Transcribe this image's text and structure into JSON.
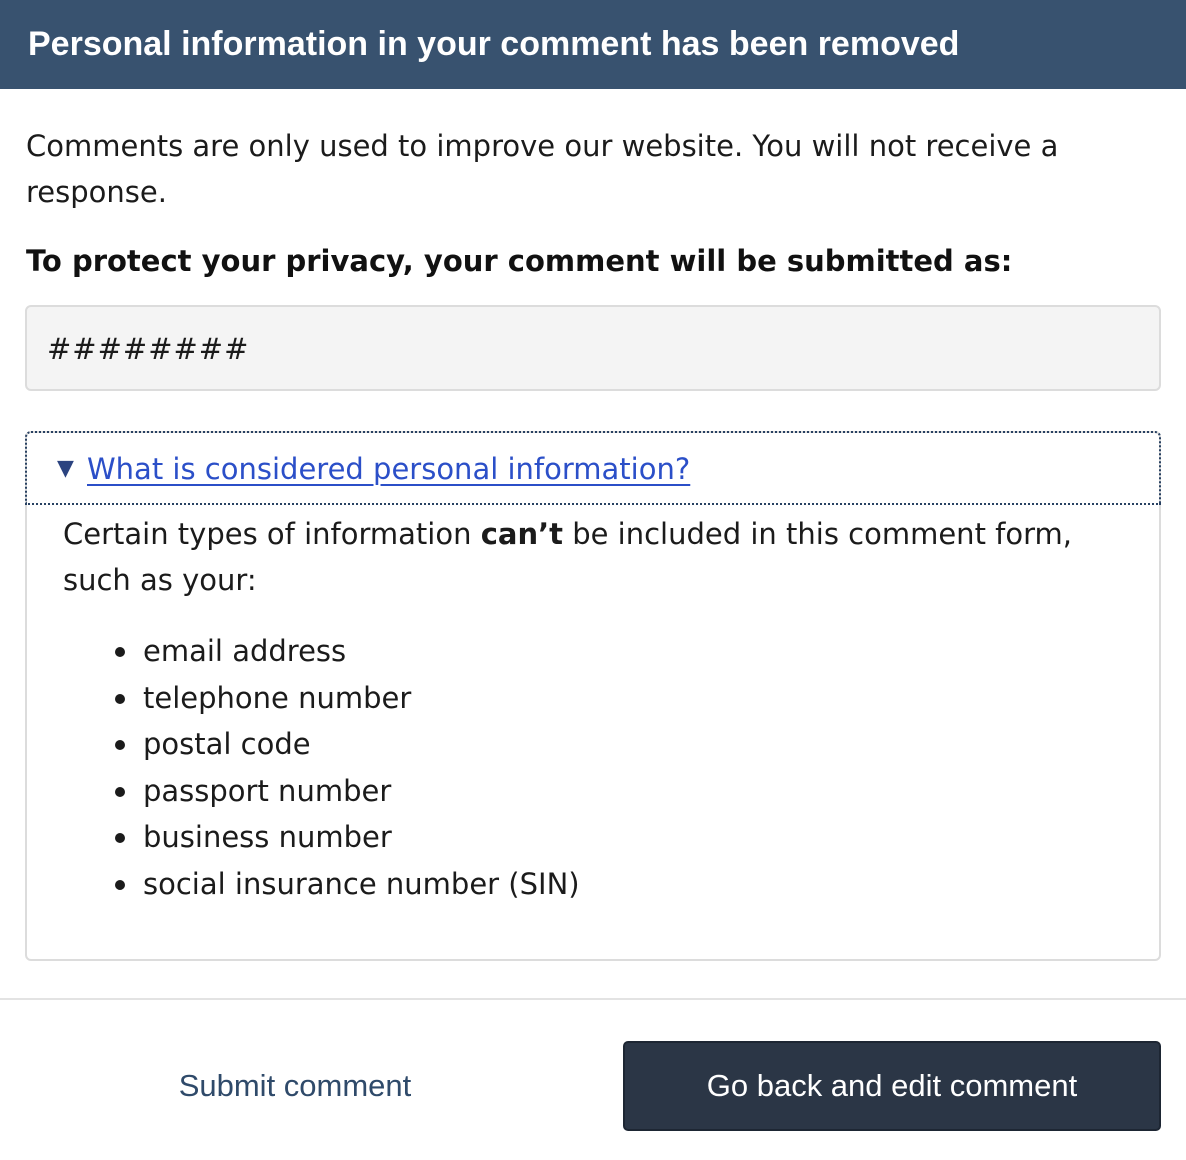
{
  "dialog": {
    "title": "Personal information in your comment has been removed",
    "intro": "Comments are only used to improve our website. You will not receive a response.",
    "privacy_label": "To protect your privacy, your comment will be submitted as:",
    "redacted_comment": "########"
  },
  "details": {
    "arrow": "▼",
    "summary": "What is considered personal information?",
    "body_before": "Certain types of information ",
    "body_bold": "can’t",
    "body_after": " be included in this comment form, such as your:",
    "items": [
      "email address",
      "telephone number",
      "postal code",
      "passport number",
      "business number",
      "social insurance number (SIN)"
    ]
  },
  "actions": {
    "submit_label": "Submit comment",
    "edit_label": "Go back and edit comment"
  },
  "colors": {
    "header_bg": "#38526f",
    "link": "#2b4fc8",
    "primary_button_bg": "#2b3646",
    "secondary_button_text": "#2f4a6a"
  }
}
